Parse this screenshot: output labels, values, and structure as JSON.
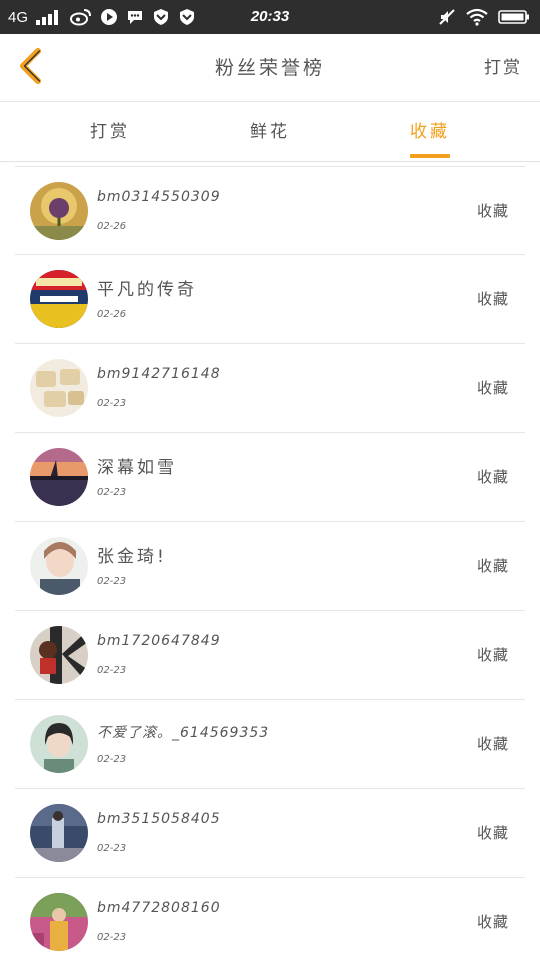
{
  "status_bar": {
    "network": "4G",
    "time": "20:33",
    "icons": [
      "signal-bars-icon",
      "weibo-icon",
      "play-icon",
      "chat-icon",
      "shield-icon",
      "shield-icon",
      "mute-icon",
      "wifi-icon",
      "battery-icon"
    ]
  },
  "header": {
    "back_icon": "chevron-left-icon",
    "title": "粉丝荣誉榜",
    "right_action": "打赏",
    "accent_color": "#f0a01c"
  },
  "tabs": [
    {
      "label": "打赏",
      "active": false
    },
    {
      "label": "鲜花",
      "active": false
    },
    {
      "label": "收藏",
      "active": true
    }
  ],
  "list": [
    {
      "name": "bm0314550309",
      "date": "02-26",
      "action": "收藏"
    },
    {
      "name": "平凡的传奇",
      "date": "02-26",
      "action": "收藏"
    },
    {
      "name": "bm9142716148",
      "date": "02-23",
      "action": "收藏"
    },
    {
      "name": "深幕如雪",
      "date": "02-23",
      "action": "收藏"
    },
    {
      "name": "张金琦!",
      "date": "02-23",
      "action": "收藏"
    },
    {
      "name": "bm1720647849",
      "date": "02-23",
      "action": "收藏"
    },
    {
      "name": "不爱了滚。_614569353",
      "date": "02-23",
      "action": "收藏"
    },
    {
      "name": "bm3515058405",
      "date": "02-23",
      "action": "收藏"
    },
    {
      "name": "bm4772808160",
      "date": "02-23",
      "action": "收藏"
    }
  ]
}
